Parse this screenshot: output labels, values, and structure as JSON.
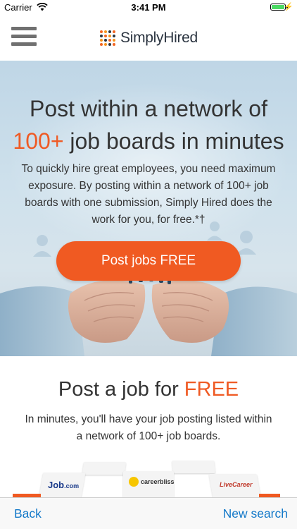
{
  "status_bar": {
    "carrier": "Carrier",
    "time": "3:41 PM",
    "battery_level": 1.0,
    "battery_color": "#4cd964"
  },
  "header": {
    "logo_text": "SimplyHired",
    "menu_icon": "hamburger-icon"
  },
  "hero": {
    "title_line1": "Post within a network of",
    "title_accent": "100+",
    "title_line2_rest": " job boards in minutes",
    "description": "To quickly hire great employees, you need maximum exposure. By posting within a network of 100+ job boards with one submission, Simply Hired does the work for you, for free.",
    "footnote_mark": "*†",
    "cta_label": "Post jobs FREE"
  },
  "section": {
    "title_prefix": "Post a job for ",
    "title_accent": "FREE",
    "description": "In minutes, you'll have your job posting listed within a network of 100+ job boards."
  },
  "boards": {
    "jobcom": "Job",
    "jobcom_suffix": ".com",
    "careerbliss": "careerbliss",
    "livecareer": "LiveCareer"
  },
  "bottom_bar": {
    "back_label": "Back",
    "new_search_label": "New search"
  },
  "colors": {
    "accent": "#ef5a24",
    "cta": "#f05a22",
    "link": "#1479c9"
  }
}
